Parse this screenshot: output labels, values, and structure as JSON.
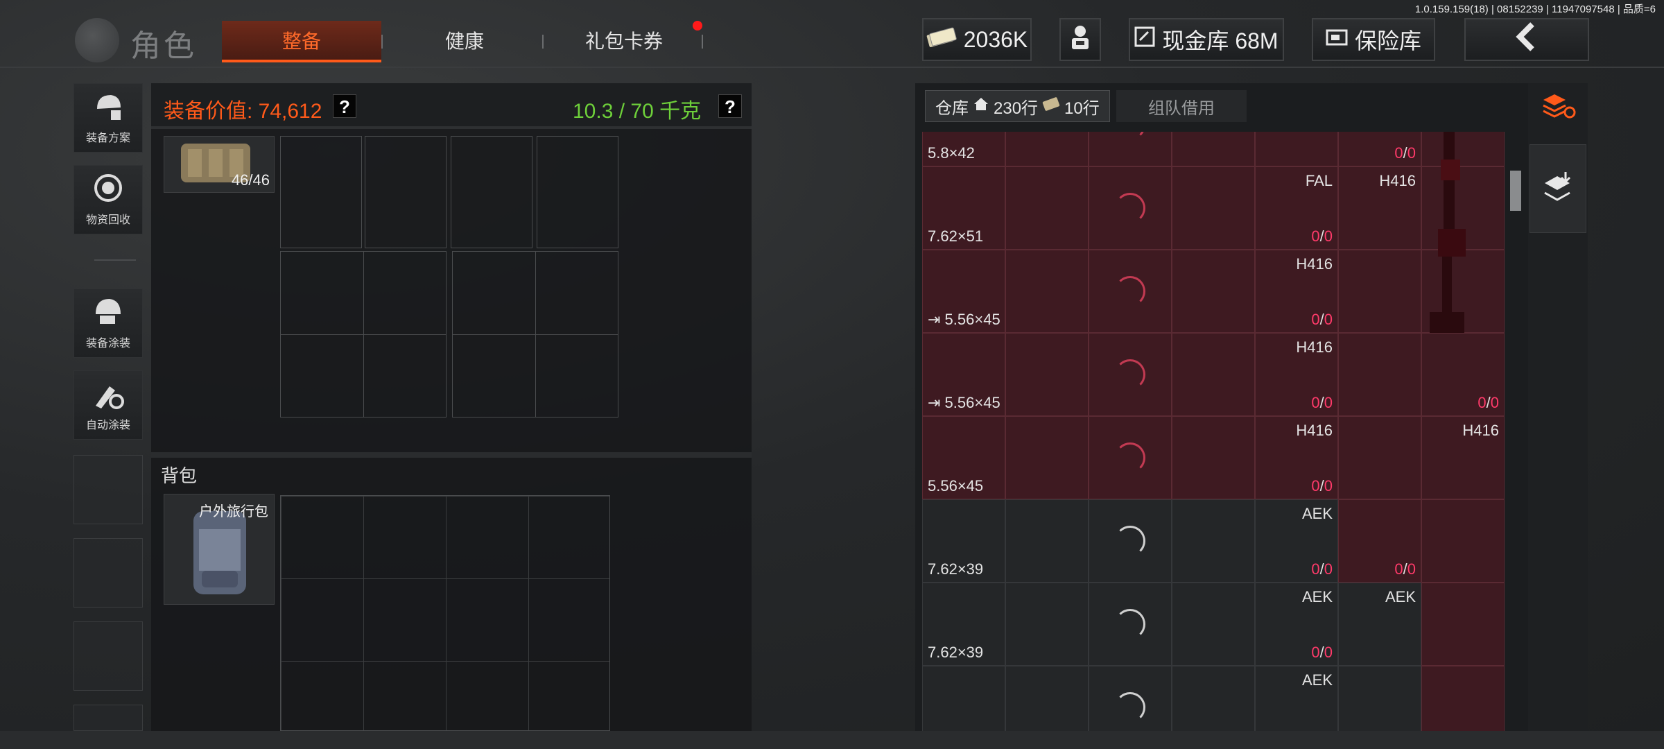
{
  "meta": {
    "version": "1.0.159.159(18) | 08152239 | 11947097548 | 品质=6"
  },
  "header": {
    "title": "角色",
    "tabs": [
      {
        "label": "整备",
        "active": true
      },
      {
        "label": "健康",
        "active": false
      },
      {
        "label": "礼包卡券",
        "active": false,
        "badge": true
      }
    ],
    "currency": "2036K",
    "cash_vault": "现金库 68M",
    "safe_box": "保险库",
    "colors": {
      "accent": "#ff5a1a",
      "badge": "#ff1a1a"
    }
  },
  "sidebar": {
    "items": [
      {
        "label": "装备方案",
        "icon": "loadout-icon"
      },
      {
        "label": "物资回收",
        "icon": "recycle-icon"
      },
      {
        "label": "装备涂装",
        "icon": "helmet-paint-icon"
      },
      {
        "label": "自动涂装",
        "icon": "auto-paint-icon"
      }
    ]
  },
  "equipment": {
    "value_label": "装备价值: 74,612",
    "weight_label": "10.3 / 70 千克",
    "help": "?",
    "vest_durability": "46/46",
    "backpack_section": "背包",
    "backpack_name": "户外旅行包"
  },
  "warehouse": {
    "tab_label": "仓库",
    "rows_label": "230行",
    "extra_rows_label": "10行",
    "team_borrow": "组队借用",
    "rows": [
      {
        "ammo": "5.8×42",
        "ext": false,
        "labels": [],
        "counts": [
          {
            "col": 5,
            "a": "0",
            "b": "0"
          }
        ]
      },
      {
        "ammo": "7.62×51",
        "ext": false,
        "labels": [
          {
            "col": 4,
            "t": "FAL"
          },
          {
            "col": 5,
            "t": "H416"
          }
        ],
        "counts": [
          {
            "col": 4,
            "a": "0",
            "b": "0"
          }
        ]
      },
      {
        "ammo": "5.56×45",
        "ext": true,
        "labels": [
          {
            "col": 4,
            "t": "H416"
          }
        ],
        "counts": [
          {
            "col": 4,
            "a": "0",
            "b": "0"
          }
        ]
      },
      {
        "ammo": "5.56×45",
        "ext": true,
        "labels": [
          {
            "col": 4,
            "t": "H416"
          }
        ],
        "counts": [
          {
            "col": 4,
            "a": "0",
            "b": "0"
          },
          {
            "col": 6,
            "a": "0",
            "b": "0"
          }
        ]
      },
      {
        "ammo": "5.56×45",
        "ext": false,
        "labels": [
          {
            "col": 4,
            "t": "H416"
          },
          {
            "col": 6,
            "t": "H416"
          }
        ],
        "counts": [
          {
            "col": 4,
            "a": "0",
            "b": "0"
          }
        ]
      },
      {
        "ammo": "7.62×39",
        "ext": false,
        "labels": [
          {
            "col": 4,
            "t": "AEK"
          }
        ],
        "counts": [
          {
            "col": 4,
            "a": "0",
            "b": "0"
          },
          {
            "col": 5,
            "a": "0",
            "b": "0"
          }
        ]
      },
      {
        "ammo": "7.62×39",
        "ext": false,
        "labels": [
          {
            "col": 4,
            "t": "AEK"
          },
          {
            "col": 5,
            "t": "AEK"
          }
        ],
        "counts": [
          {
            "col": 4,
            "a": "0",
            "b": "0"
          }
        ]
      },
      {
        "ammo": "",
        "ext": false,
        "labels": [
          {
            "col": 4,
            "t": "AEK"
          }
        ],
        "counts": []
      }
    ]
  }
}
